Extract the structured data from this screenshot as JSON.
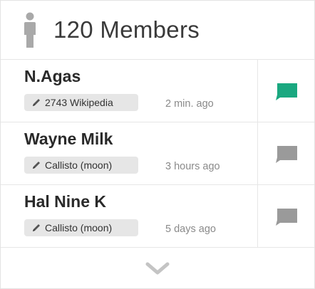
{
  "header": {
    "title": "120 Members",
    "icon": "person-icon"
  },
  "members": [
    {
      "name": "N.Agas",
      "tag": "2743 Wikipedia",
      "time": "2 min. ago",
      "chat_color": "#1aa880"
    },
    {
      "name": "Wayne Milk",
      "tag": "Callisto (moon)",
      "time": "3 hours ago",
      "chat_color": "#9a9a9a"
    },
    {
      "name": "Hal Nine K",
      "tag": "Callisto (moon)",
      "time": "5 days ago",
      "chat_color": "#9a9a9a"
    }
  ],
  "footer": {
    "icon": "chevron-down-icon"
  },
  "colors": {
    "active": "#1aa880",
    "inactive": "#9a9a9a",
    "icon_gray": "#a9a9a9"
  }
}
